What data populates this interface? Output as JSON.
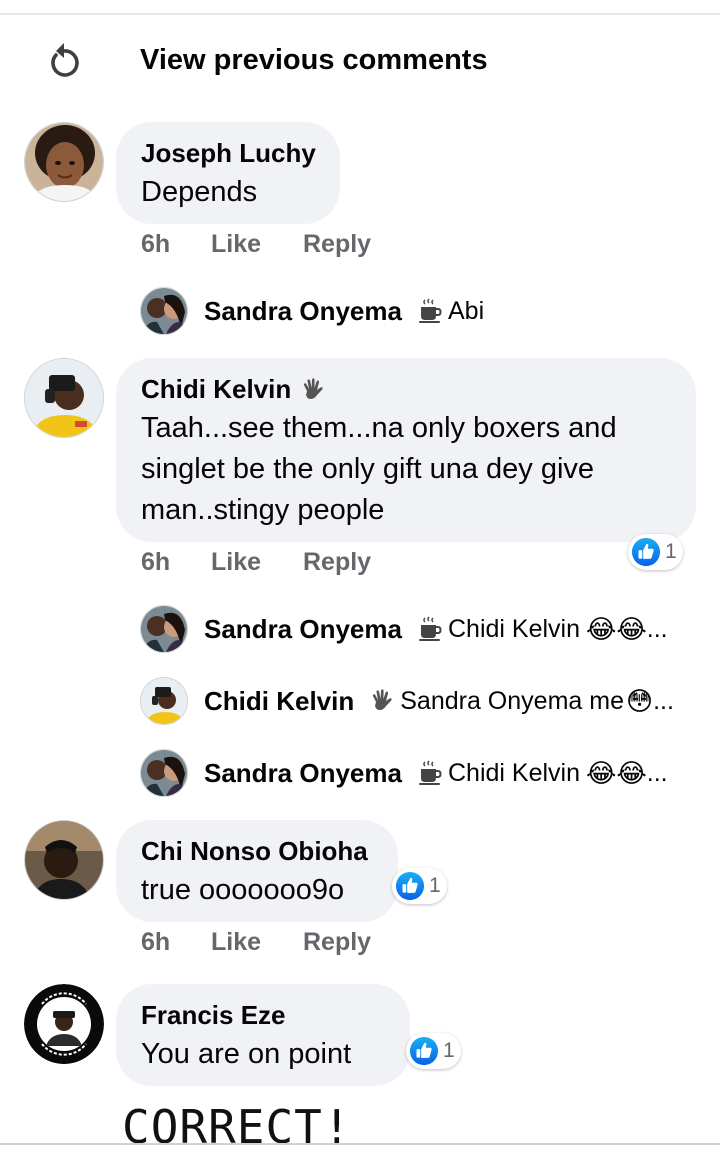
{
  "view_previous": {
    "label": "View previous comments",
    "icon": "refresh-icon"
  },
  "comments": [
    {
      "author": "Joseph Luchy",
      "text": "Depends",
      "time": "6h",
      "like": "Like",
      "reply": "Reply"
    },
    {
      "author": "Chidi Kelvin",
      "badge": "wave-hand-icon",
      "lines": [
        "Taah...see them...na only boxers and",
        "singlet be the only gift una dey give",
        "man..stingy people"
      ],
      "time": "6h",
      "like": "Like",
      "reply": "Reply",
      "reaction_count": "1"
    },
    {
      "author": "Chi Nonso Obioha",
      "text": "true ooooooo9o",
      "time": "6h",
      "like": "Like",
      "reply": "Reply",
      "reaction_count": "1"
    },
    {
      "author": "Francis Eze",
      "text": "You are on point",
      "reaction_count": "1"
    }
  ],
  "replies": [
    {
      "author": "Sandra Onyema",
      "badge": "coffee-cup-icon",
      "text": "Abi"
    },
    {
      "author": "Sandra Onyema",
      "badge": "coffee-cup-icon",
      "text": "Chidi Kelvin",
      "emoji": "😂😂",
      "ellipsis": "..."
    },
    {
      "author": "Chidi Kelvin",
      "badge": "wave-hand-icon",
      "text": "Sandra Onyema me",
      "emoji": "😳",
      "ellipsis": "..."
    },
    {
      "author": "Sandra Onyema",
      "badge": "coffee-cup-icon",
      "text": "Chidi Kelvin",
      "emoji": "😂😂",
      "ellipsis": "..."
    }
  ],
  "annotation": "CORRECT!",
  "colors": {
    "bubble": "#f0f2f5",
    "like_blue": "#1877f2",
    "meta_gray": "#65676b"
  }
}
